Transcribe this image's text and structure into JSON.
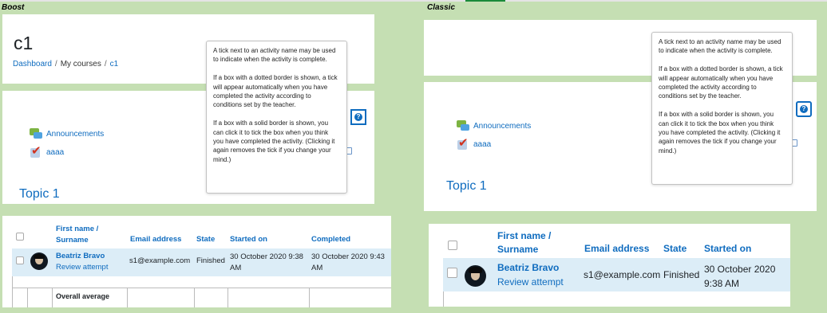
{
  "boost": {
    "label": "Boost",
    "course_title": "c1",
    "breadcrumb": {
      "dashboard": "Dashboard",
      "my_courses": "My courses",
      "course": "c1",
      "separator": "/"
    },
    "activities": [
      {
        "name": "Announcements"
      },
      {
        "name": "aaaa"
      }
    ],
    "topic": "Topic 1"
  },
  "classic": {
    "label": "Classic",
    "activities": [
      {
        "name": "Announcements"
      },
      {
        "name": "aaaa"
      }
    ],
    "topic": "Topic 1"
  },
  "help_tooltip": {
    "p1": "A tick next to an activity name may be used to indicate when the activity is complete.",
    "p2": "If a box with a dotted border is shown, a tick will appear automatically when you have completed the activity according to conditions set by the teacher.",
    "p3": "If a box with a solid border is shown, you can click it to tick the box when you think you have completed the activity. (Clicking it again removes the tick if you change your mind.)"
  },
  "attempts_table": {
    "headers": {
      "first_name": "First name",
      "slash": " /",
      "surname": "Surname",
      "email": "Email address",
      "state": "State",
      "started_on": "Started on",
      "completed": "Completed"
    },
    "row": {
      "name": "Beatriz Bravo",
      "review": "Review attempt",
      "email": "s1@example.com",
      "state": "Finished",
      "started_boost": "30 October 2020 9:38 AM",
      "completed_boost": "30 October 2020 9:43 AM",
      "started_classic_l1": "30 October 2020",
      "started_classic_l2": "9:38 AM"
    },
    "overall_average": "Overall average"
  },
  "colors": {
    "background": "#c5dfb3",
    "link": "#0f6cbf",
    "row_highlight": "#dcedf7"
  }
}
